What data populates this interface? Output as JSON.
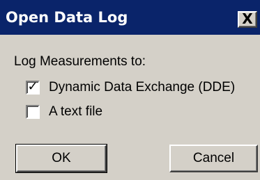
{
  "window": {
    "title": "Open Data Log",
    "close_glyph": "X"
  },
  "log_group": {
    "label": "Log Measurements to:",
    "options": [
      {
        "label": "Dynamic Data Exchange (DDE)",
        "checked": true,
        "check_glyph": "✓"
      },
      {
        "label": "A text file",
        "checked": false,
        "check_glyph": ""
      }
    ]
  },
  "buttons": {
    "ok_label": "OK",
    "cancel_label": "Cancel"
  },
  "colors": {
    "titlebar": "#0a246a",
    "title_text": "#ffffff",
    "dialog_face": "#d4d0c8"
  },
  "icons": {
    "close": "close-icon",
    "check": "checkmark-icon"
  }
}
